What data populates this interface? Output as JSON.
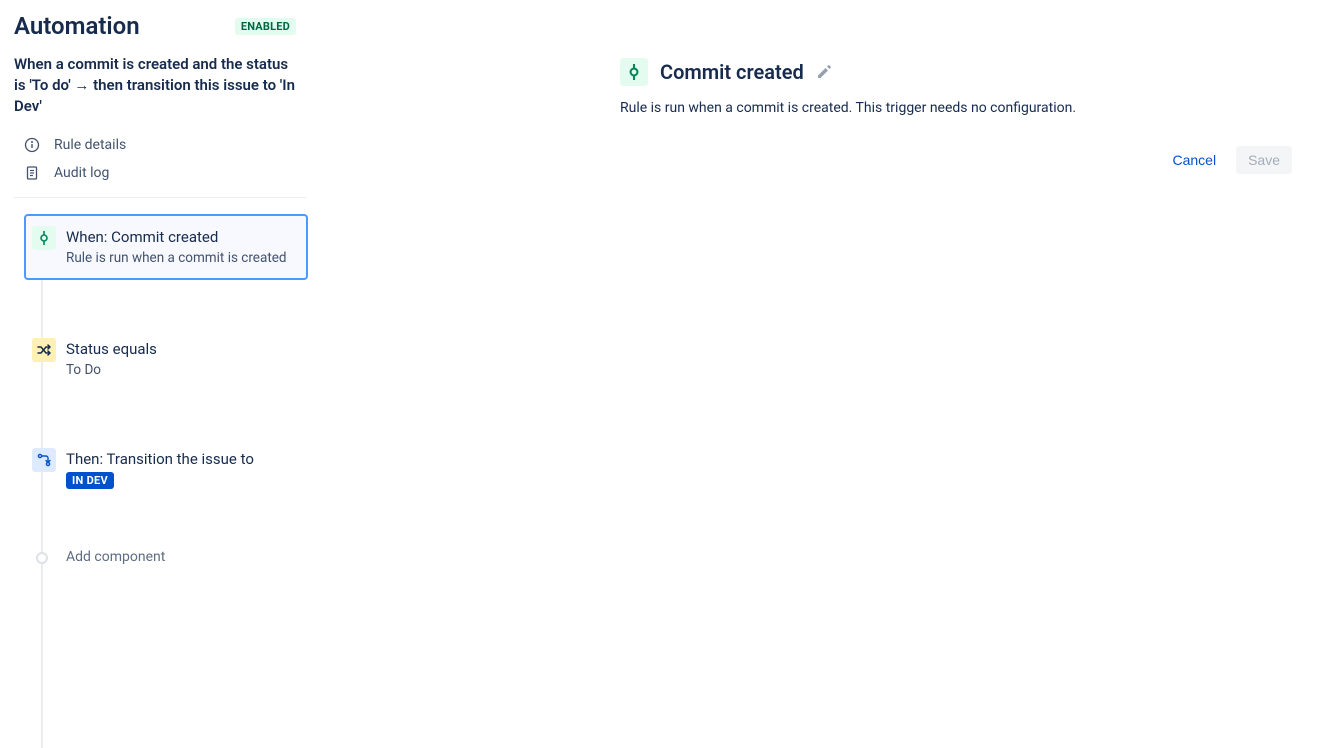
{
  "header": {
    "title": "Automation",
    "status": "ENABLED"
  },
  "rule": {
    "name": "When a commit is created and the status is 'To do' → then transition this issue to 'In Dev'"
  },
  "nav": {
    "details": "Rule details",
    "audit": "Audit log"
  },
  "flow": {
    "when": {
      "title": "When: Commit created",
      "sub": "Rule is run when a commit is created"
    },
    "cond": {
      "title": "Status equals",
      "sub": "To Do"
    },
    "then": {
      "title": "Then: Transition the issue to",
      "lozenge": "IN DEV"
    },
    "add": "Add component"
  },
  "panel": {
    "title": "Commit created",
    "desc": "Rule is run when a commit is created. This trigger needs no configuration."
  },
  "actions": {
    "cancel": "Cancel",
    "save": "Save"
  }
}
